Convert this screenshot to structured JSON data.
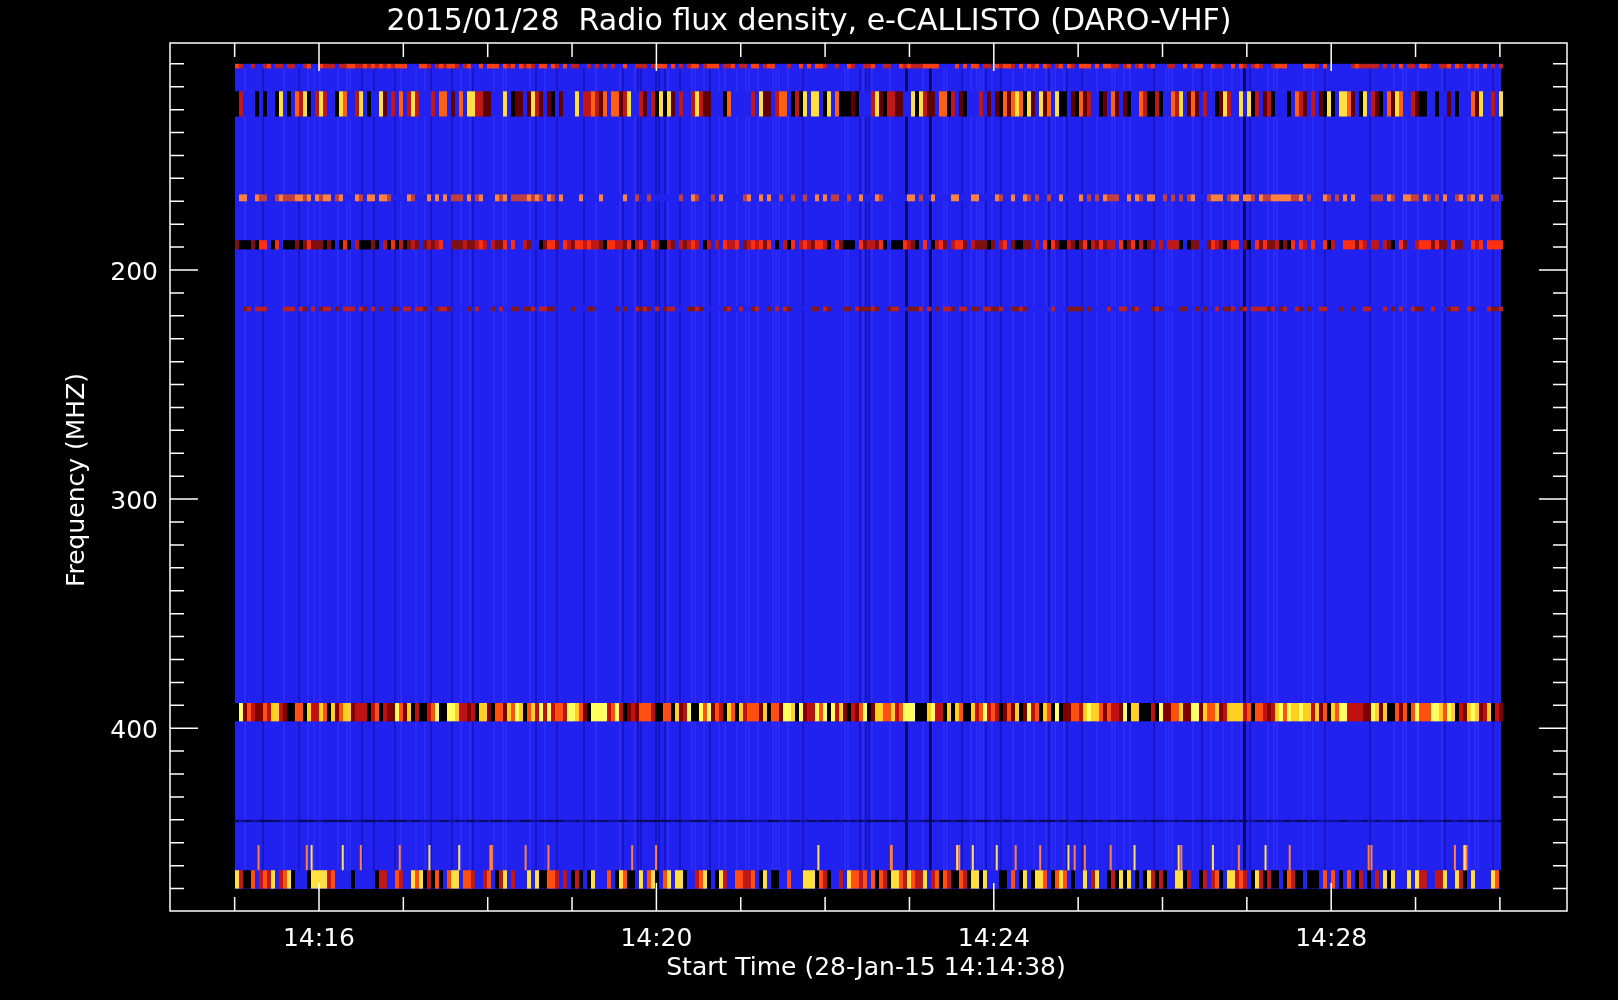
{
  "title": "2015/01/28  Radio flux density, e-CALLISTO (DARO-VHF)",
  "ylabel": "Frequency (MHZ)",
  "xlabel": "Start Time (28-Jan-15 14:14:38)",
  "y_tick_labels": [
    "200",
    "300",
    "400"
  ],
  "x_tick_labels": [
    "14:16",
    "14:20",
    "14:24",
    "14:28"
  ]
}
